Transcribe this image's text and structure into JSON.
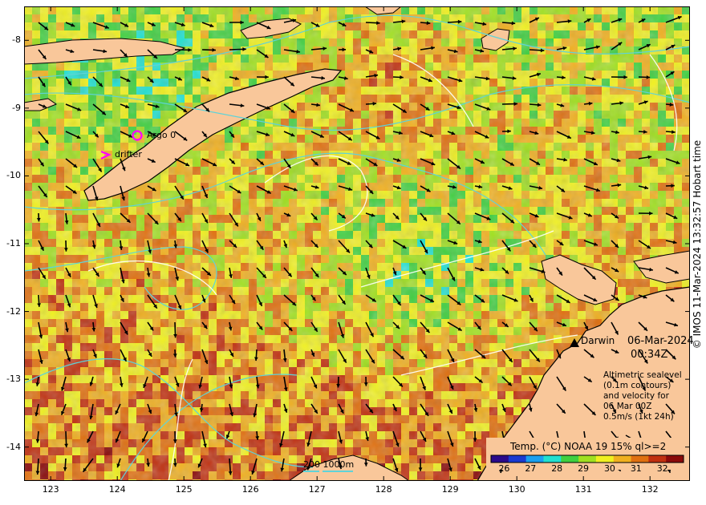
{
  "map": {
    "lon_range": [
      122.6,
      132.6
    ],
    "lat_range": [
      -14.5,
      -7.5
    ],
    "lon_ticks": [
      "123",
      "124",
      "125",
      "126",
      "127",
      "128",
      "129",
      "130",
      "131",
      "132"
    ],
    "lat_ticks": [
      "-8",
      "-9",
      "-10",
      "-11",
      "-12",
      "-13",
      "-14"
    ],
    "land_color": "#f9c79a",
    "contour_color": "#5fd3d8",
    "sealevel_contour_color": "#ffffff"
  },
  "labels": {
    "date": "06-Mar-2024",
    "time": "00:34Z",
    "darwin": "Darwin",
    "note_lines": [
      "Altimetric sealevel",
      "(0.1m contours)",
      "and velocity for",
      "06 Mar 00Z",
      "0.5m/s (1kt 24h)"
    ],
    "argo": "Argo 0",
    "drifter": "drifter",
    "isobath_scale": "200  1000m",
    "copyright": "© IMOS 11-Mar-2024 13:32:57 Hobart time"
  },
  "colorbar": {
    "title": "Temp. (°C) NOAA 19 15% ql>=2",
    "ticks": [
      "26",
      "27",
      "28",
      "29",
      "30",
      "31",
      "32"
    ],
    "range": [
      25.5,
      32.8
    ],
    "stops": [
      "#2a0a8a",
      "#1a3ad0",
      "#1aa0f0",
      "#20e0d0",
      "#40d040",
      "#a0e020",
      "#f0f020",
      "#f0b020",
      "#e07010",
      "#c03010",
      "#8a0a0a"
    ]
  },
  "markers": {
    "argo_color": "#ff00ff",
    "drifter_color": "#ff00ff",
    "darwin_marker": "city-marker"
  }
}
